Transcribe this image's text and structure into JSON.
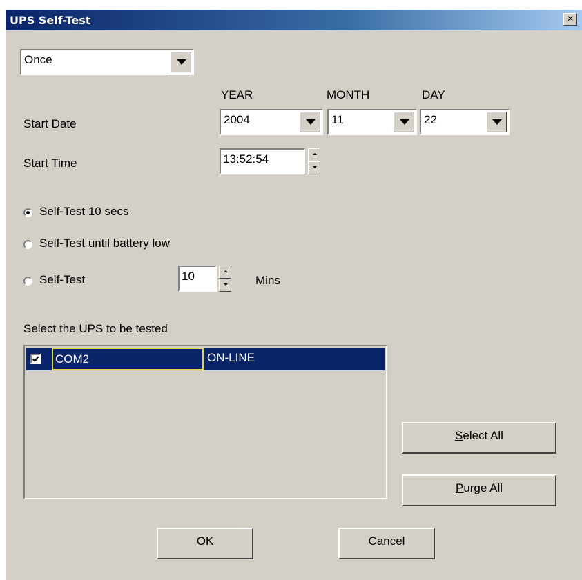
{
  "window": {
    "title": "UPS Self-Test",
    "close_glyph": "×"
  },
  "schedule": {
    "selected": "Once"
  },
  "date": {
    "label": "Start Date",
    "year_header": "YEAR",
    "month_header": "MONTH",
    "day_header": "DAY",
    "year": "2004",
    "month": "11",
    "day": "22"
  },
  "time": {
    "label": "Start Time",
    "value": "13:52:54"
  },
  "options": {
    "opt1": "Self-Test 10 secs",
    "opt2": "Self-Test until battery low",
    "opt3": "Self-Test",
    "minutes_value": "10",
    "minutes_unit": "Mins",
    "selected_index": 0
  },
  "ups_list": {
    "label": "Select the UPS to be tested",
    "items": [
      {
        "name": "COM2",
        "status": "ON-LINE",
        "checked": true,
        "selected": true
      }
    ]
  },
  "buttons": {
    "select_all_mnemonic": "S",
    "select_all_rest": "elect All",
    "purge_all_mnemonic": "P",
    "purge_all_rest": "urge All",
    "ok": "OK",
    "cancel_mnemonic": "C",
    "cancel_rest": "ancel"
  },
  "colors": {
    "title_bar": "#0a246a",
    "selection": "#0a246a",
    "focus_border": "#e4d44a",
    "dialog_bg": "#d4d0c8"
  }
}
